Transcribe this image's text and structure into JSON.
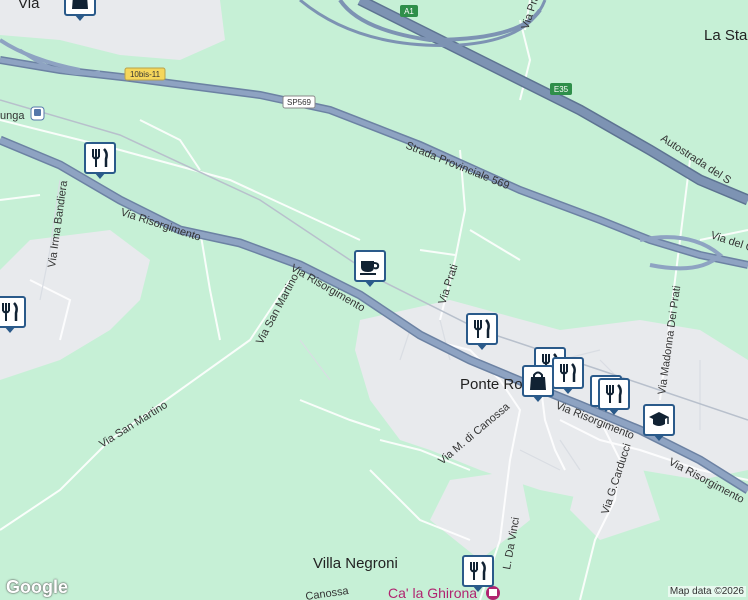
{
  "map": {
    "places": {
      "la_sta": "La Sta",
      "ponte_ro": "Ponte Ro",
      "villa_negroni": "Villa Negroni",
      "ca_la_ghirona": "Ca' la Ghirona",
      "via_top": "Via",
      "lunga": "unga"
    },
    "road_labels": {
      "via_risorgimento_1": "Via Risorgimento",
      "via_risorgimento_2": "Via Risorgimento",
      "via_risorgimento_3": "Via Risorgimento",
      "via_risorgimento_4": "Via Risorgimento",
      "strada_provinciale": "Strada Provinciale 569",
      "autostrada": "Autostrada del S",
      "via_prati": "Via Prati",
      "via_prati_2": "Via Prati",
      "via_irma_bandiera": "Via Irma Bandiera",
      "via_san_martino_1": "Via San Martino",
      "via_san_martino_2": "Via San Martino",
      "via_m_di_canossa": "Via M. di Canossa",
      "via_madonna_dei_prati": "Via Madonna Dei Prati",
      "via_g_carducci": "Via G.Carducci",
      "via_l_da_vinci": "L. Da Vinci",
      "via_del": "Via del C",
      "canossa": "Canossa"
    },
    "shields": {
      "a1": "A1",
      "e35": "E35",
      "sp569": "SP569",
      "bis": "10bis-11"
    },
    "pois": [
      {
        "icon": "restaurant-icon",
        "label": "restaurant"
      },
      {
        "icon": "restaurant-icon",
        "label": "restaurant"
      },
      {
        "icon": "cafe-icon",
        "label": "cafe"
      },
      {
        "icon": "restaurant-icon",
        "label": "restaurant"
      },
      {
        "icon": "shopping-bag-icon",
        "label": "shop"
      },
      {
        "icon": "restaurant-icon",
        "label": "restaurant"
      },
      {
        "icon": "restaurant-icon",
        "label": "restaurant"
      },
      {
        "icon": "school-icon",
        "label": "school"
      },
      {
        "icon": "restaurant-icon",
        "label": "restaurant"
      }
    ],
    "attribution": "Map data ©2026",
    "logo": "Google",
    "colors": {
      "background": "#c6f0d6",
      "urban": "#e8eaed",
      "highway": "#7d93b3",
      "pin_border": "#2a5a8a"
    }
  }
}
